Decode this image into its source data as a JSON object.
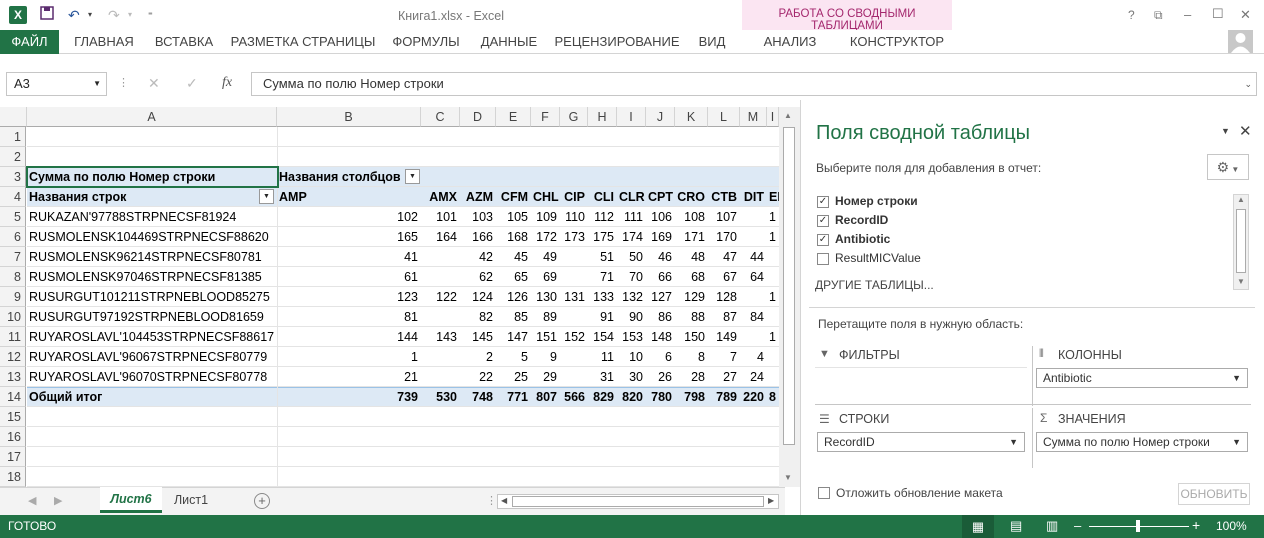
{
  "window": {
    "title": "Книга1.xlsx - Excel",
    "help": "?",
    "min": "–",
    "max": "☐",
    "close": "✕"
  },
  "ribbon": {
    "file": "ФАЙЛ",
    "tabs": [
      "ГЛАВНАЯ",
      "ВСТАВКА",
      "РАЗМЕТКА СТРАНИЦЫ",
      "ФОРМУЛЫ",
      "ДАННЫЕ",
      "РЕЦЕНЗИРОВАНИЕ",
      "ВИД"
    ],
    "context_title": "РАБОТА СО СВОДНЫМИ ТАБЛИЦАМИ",
    "context_tabs": [
      "АНАЛИЗ",
      "КОНСТРУКТОР"
    ]
  },
  "formula": {
    "name_box": "A3",
    "fx": "fx",
    "content": "Сумма по полю Номер строки"
  },
  "grid": {
    "columns": [
      "A",
      "B",
      "C",
      "D",
      "E",
      "F",
      "G",
      "H",
      "I",
      "J",
      "K",
      "L",
      "M",
      "I"
    ],
    "rows": [
      "1",
      "2",
      "3",
      "4",
      "5",
      "6",
      "7",
      "8",
      "9",
      "10",
      "11",
      "12",
      "13",
      "14",
      "15",
      "16",
      "17",
      "18"
    ],
    "pivot": {
      "sum_label": "Сумма по полю Номер строки",
      "col_labels": "Названия столбцов",
      "row_labels": "Названия строк",
      "antibiotics": [
        "AMP",
        "AMX",
        "AZM",
        "CFM",
        "CHL",
        "CIP",
        "CLI",
        "CLR",
        "CPT",
        "CRO",
        "CTB",
        "DIT",
        "EI"
      ],
      "records": [
        {
          "name": "RUKAZAN'97788STRPNECSF81924",
          "vals": [
            "102",
            "101",
            "103",
            "105",
            "109",
            "110",
            "112",
            "111",
            "106",
            "108",
            "107",
            "",
            "1"
          ]
        },
        {
          "name": "RUSMOLENSK104469STRPNECSF88620",
          "vals": [
            "165",
            "164",
            "166",
            "168",
            "172",
            "173",
            "175",
            "174",
            "169",
            "171",
            "170",
            "",
            "1"
          ]
        },
        {
          "name": "RUSMOLENSK96214STRPNECSF80781",
          "vals": [
            "41",
            "",
            "42",
            "45",
            "49",
            "",
            "51",
            "50",
            "46",
            "48",
            "47",
            "44",
            ""
          ]
        },
        {
          "name": "RUSMOLENSK97046STRPNECSF81385",
          "vals": [
            "61",
            "",
            "62",
            "65",
            "69",
            "",
            "71",
            "70",
            "66",
            "68",
            "67",
            "64",
            ""
          ]
        },
        {
          "name": "RUSURGUT101211STRPNEBLOOD85275",
          "vals": [
            "123",
            "122",
            "124",
            "126",
            "130",
            "131",
            "133",
            "132",
            "127",
            "129",
            "128",
            "",
            "1"
          ]
        },
        {
          "name": "RUSURGUT97192STRPNEBLOOD81659",
          "vals": [
            "81",
            "",
            "82",
            "85",
            "89",
            "",
            "91",
            "90",
            "86",
            "88",
            "87",
            "84",
            ""
          ]
        },
        {
          "name": "RUYAROSLAVL'104453STRPNECSF88617",
          "vals": [
            "144",
            "143",
            "145",
            "147",
            "151",
            "152",
            "154",
            "153",
            "148",
            "150",
            "149",
            "",
            "1"
          ]
        },
        {
          "name": "RUYAROSLAVL'96067STRPNECSF80779",
          "vals": [
            "1",
            "",
            "2",
            "5",
            "9",
            "",
            "11",
            "10",
            "6",
            "8",
            "7",
            "4",
            ""
          ]
        },
        {
          "name": "RUYAROSLAVL'96070STRPNECSF80778",
          "vals": [
            "21",
            "",
            "22",
            "25",
            "29",
            "",
            "31",
            "30",
            "26",
            "28",
            "27",
            "24",
            ""
          ]
        }
      ],
      "total": {
        "name": "Общий итог",
        "vals": [
          "739",
          "530",
          "748",
          "771",
          "807",
          "566",
          "829",
          "820",
          "780",
          "798",
          "789",
          "220",
          "8"
        ]
      }
    }
  },
  "sheets": {
    "tabs": [
      "Лист6",
      "Лист1"
    ],
    "active": "Лист6",
    "add": "+"
  },
  "pane": {
    "title": "Поля сводной таблицы",
    "choose": "Выберите поля для добавления в отчет:",
    "fields": [
      {
        "label": "Номер строки",
        "checked": true
      },
      {
        "label": "RecordID",
        "checked": true
      },
      {
        "label": "Antibiotic",
        "checked": true
      },
      {
        "label": "ResultMICValue",
        "checked": false
      }
    ],
    "other_tables": "ДРУГИЕ ТАБЛИЦЫ...",
    "drag": "Перетащите поля в нужную область:",
    "filters": "ФИЛЬТРЫ",
    "columns": "КОЛОННЫ",
    "columns_item": "Antibiotic",
    "rows": "СТРОКИ",
    "rows_item": "RecordID",
    "values": "ЗНАЧЕНИЯ",
    "values_item": "Сумма по полю Номер строки",
    "defer": "Отложить обновление макета",
    "update": "ОБНОВИТЬ"
  },
  "status": {
    "ready": "ГОТОВО",
    "zoom": "100%",
    "minus": "–",
    "plus": "+"
  }
}
